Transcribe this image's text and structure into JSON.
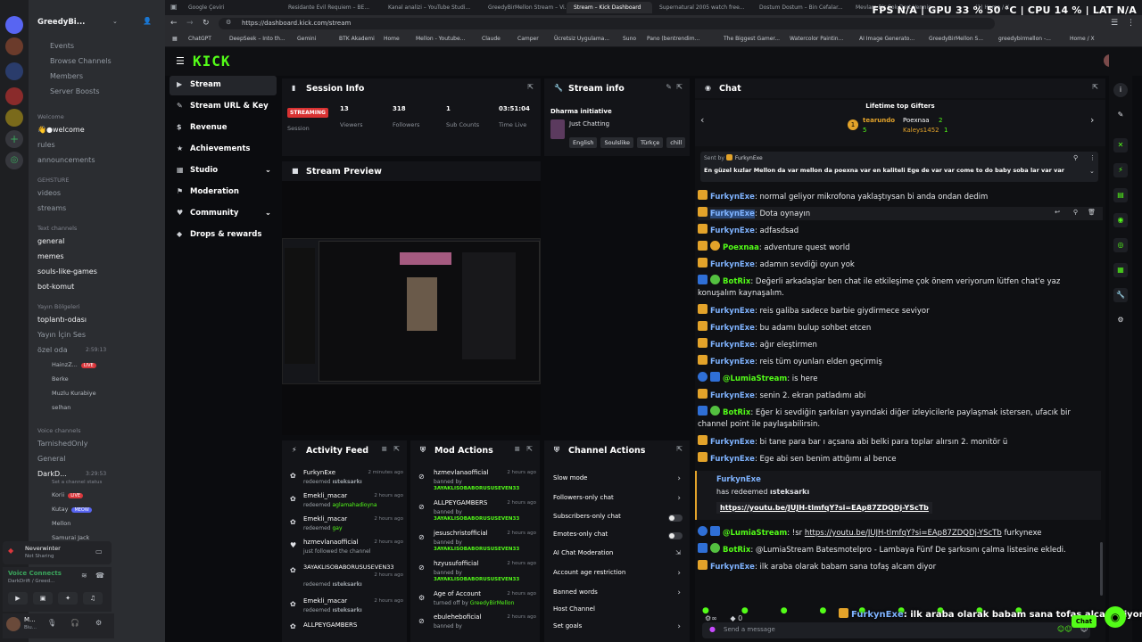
{
  "overlay_stats": "FPS N/A | GPU 33 % 50 °C | CPU 14 % | LAT N/A",
  "discord": {
    "server_name": "GreedyBi...",
    "nav": [
      "Events",
      "Browse Channels",
      "Members",
      "Server Boosts"
    ],
    "cat_welcome": "Welcome",
    "ch_welcome": "👋●welcome",
    "ch_rules": "rules",
    "ch_ann": "announcements",
    "cat_gehsture": "GEHSTURE",
    "ch_videos": "videos",
    "ch_streams": "streams",
    "cat_text": "Text channels",
    "text_channels": [
      "general",
      "memes",
      "souls-like-games",
      "bot-komut"
    ],
    "cat_yayin": "Yayın Bölgeleri",
    "ch_toplanti": "toplantı-odası",
    "ch_yayin_ses": "Yayın İçin Ses",
    "ch_ozel": "özel oda",
    "ozel_time": "2:59:13",
    "voice_users1": [
      {
        "name": "HainzZ...",
        "live": "LIVE"
      },
      {
        "name": "Berke",
        "live": ""
      },
      {
        "name": "Muzlu Kurabiye",
        "live": ""
      },
      {
        "name": "selhan",
        "live": ""
      }
    ],
    "cat_voice": "Voice channels",
    "ch_tarnished": "TarnishedOnly",
    "ch_general_v": "General",
    "ch_darkd": "DarkD...",
    "darkd_time": "3:29:53",
    "darkd_status": "Set a channel status",
    "voice_users2": [
      {
        "name": "Korii",
        "live": "LIVE"
      },
      {
        "name": "Kutay",
        "live": "MEOW"
      },
      {
        "name": "Mellon",
        "live": ""
      },
      {
        "name": "Samurai Jack",
        "live": ""
      }
    ],
    "nw_title": "Neverwinter",
    "nw_sub": "Not Sharing",
    "vc_title": "Voice Connects",
    "vc_sub": "DarkDrift / Greed...",
    "user_name": "M...",
    "user_sub": "Biu..."
  },
  "browser": {
    "tabs": [
      "Google Çeviri",
      "Residante Evil Requiem – BE...",
      "Kanal analizi – YouTube Studi...",
      "GreedyBirMellon Stream – Vi...",
      "Stream – Kick Dashboard",
      "Supernatural 2005 watch free...",
      "Dostum Dostum – Bin Cefalar...",
      "Mevlam Bir Çok Dert Vermiş...",
      "(1) Home / X"
    ],
    "url": "https://dashboard.kick.com/stream",
    "bookmarks": [
      "ChatGPT",
      "DeepSeek – Into th...",
      "Gemini",
      "BTK Akademi",
      "Home",
      "Mellon - Youtube...",
      "Claude",
      "Camper",
      "Ücretsiz Uygulama...",
      "Suno",
      "Pano (bentrendim...",
      "The Biggest Gamer...",
      "Watercolor Paintin...",
      "AI Image Generato...",
      "GreedyBirMellon S...",
      "greedybirmellon -...",
      "Home / X"
    ]
  },
  "kick": {
    "logo": "KICK",
    "nav": [
      {
        "icon": "▶",
        "label": "Stream"
      },
      {
        "icon": "✎",
        "label": "Stream URL & Key"
      },
      {
        "icon": "$",
        "label": "Revenue"
      },
      {
        "icon": "★",
        "label": "Achievements"
      },
      {
        "icon": "▦",
        "label": "Studio"
      },
      {
        "icon": "⚑",
        "label": "Moderation"
      },
      {
        "icon": "♥",
        "label": "Community"
      },
      {
        "icon": "◆",
        "label": "Drops & rewards"
      }
    ],
    "session": {
      "title": "Session Info",
      "live_badge": "STREAMING",
      "live_label": "Session",
      "stats": [
        {
          "value": "13",
          "label": "Viewers"
        },
        {
          "value": "318",
          "label": "Followers"
        },
        {
          "value": "1",
          "label": "Sub Counts"
        },
        {
          "value": "03:51:04",
          "label": "Time Live"
        }
      ]
    },
    "stream_info": {
      "title": "Stream info",
      "stream_title": "Dharma initiative",
      "category": "Just Chatting",
      "tags": [
        "English",
        "Soulslike",
        "Türkçe",
        "chill"
      ]
    },
    "preview_title": "Stream Preview",
    "activity": {
      "title": "Activity Feed",
      "items": [
        {
          "name": "FurkynExe",
          "time": "2 minutes ago",
          "action": "redeemed",
          "detail": "ısteksarkı"
        },
        {
          "name": "Emekli_macar",
          "time": "2 hours ago",
          "action": "redeemed",
          "detail": "aglamahadioyna"
        },
        {
          "name": "Emekli_macar",
          "time": "2 hours ago",
          "action": "redeemed",
          "detail": "gay"
        },
        {
          "name": "hzmevlanaofficial",
          "time": "2 hours ago",
          "action": "just followed the channel",
          "detail": ""
        },
        {
          "name": "3AYAKLISOBABORUSUSEVEN33",
          "time": "",
          "action": "",
          "detail": ""
        },
        {
          "name": "",
          "time": "2 hours ago",
          "action": "redeemed",
          "detail": "ısteksarkı"
        },
        {
          "name": "Emekli_macar",
          "time": "2 hours ago",
          "action": "redeemed",
          "detail": "ısteksarkı"
        },
        {
          "name": "ALLPEYGAMBERS",
          "time": "",
          "action": "",
          "detail": ""
        }
      ]
    },
    "mod": {
      "title": "Mod Actions",
      "items": [
        {
          "name": "hzmevlanaofficial",
          "time": "2 hours ago",
          "action": "banned by",
          "by": "3AYAKLISOBABORUSUSEVEN33"
        },
        {
          "name": "ALLPEYGAMBERS",
          "time": "2 hours ago",
          "action": "banned by",
          "by": "3AYAKLISOBABORUSUSEVEN33"
        },
        {
          "name": "jesuschristofficial",
          "time": "2 hours ago",
          "action": "banned by",
          "by": "3AYAKLISOBABORUSUSEVEN33"
        },
        {
          "name": "hzyusufofficial",
          "time": "2 hours ago",
          "action": "banned by",
          "by": "3AYAKLISOBABORUSUSEVEN33"
        },
        {
          "name": "Age of Account",
          "time": "2 hours ago",
          "action": "turned off by",
          "by": "GreedyBirMellon"
        },
        {
          "name": "ebuleheboficial",
          "time": "2 hours ago",
          "action": "banned by",
          "by": ""
        }
      ]
    },
    "channel_actions": {
      "title": "Channel Actions",
      "items": [
        {
          "label": "Slow mode",
          "control": "chevron"
        },
        {
          "label": "Followers-only chat",
          "control": "chevron"
        },
        {
          "label": "Subscribers-only chat",
          "control": "toggle"
        },
        {
          "label": "Emotes-only chat",
          "control": "toggle"
        },
        {
          "label": "AI Chat Moderation",
          "control": "ext"
        },
        {
          "label": "Account age restriction",
          "control": "chevron"
        },
        {
          "label": "Banned words",
          "control": "chevron"
        },
        {
          "label": "Host Channel",
          "control": ""
        },
        {
          "label": "Set goals",
          "control": "chevron"
        }
      ]
    },
    "chat": {
      "title": "Chat",
      "gifters_title": "Lifetime top Gifters",
      "gifters": [
        {
          "name": "tearundo",
          "count": "5"
        },
        {
          "name": "Poexnaa",
          "count": "2"
        },
        {
          "name": "Kaleys1452",
          "count": "1"
        }
      ],
      "pinned_sent_by": "Sent by",
      "pinned_user": "FurkynExe",
      "pinned_text": "En güzel kızlar Mellon da var mellon da poexna var en kaliteli Ege de var var come to do baby soba lar var var",
      "messages": [
        {
          "user": "FurkynExe",
          "text": ": normal geliyor mikrofona yaklaştıysan bi anda ondan dedim",
          "badge": "gold",
          "color": "#7fb3ff"
        },
        {
          "user": "FurkynExe",
          "text": ": Dota oynayın",
          "badge": "gold",
          "color": "#7fb3ff"
        },
        {
          "user": "FurkynExe",
          "text": ": adfasdsad",
          "badge": "gold",
          "color": "#7fb3ff"
        },
        {
          "user": "Poexnaa",
          "text": ": adventure quest world",
          "badge": "gold",
          "color": "#53fc18"
        },
        {
          "user": "FurkynExe",
          "text": ": adamın sevdiği oyun yok",
          "badge": "gold",
          "color": "#7fb3ff"
        },
        {
          "user": "BotRix",
          "text": ": Değerli arkadaşlar ben chat ile etkileşime çok önem veriyorum lütfen chat'e yaz konuşalım kaynaşalım.",
          "badge": "bot",
          "color": "#53fc18"
        },
        {
          "user": "FurkynExe",
          "text": ": reis galiba sadece barbie giydirmece seviyor",
          "badge": "gold",
          "color": "#7fb3ff"
        },
        {
          "user": "FurkynExe",
          "text": ": bu adamı bulup sohbet etcen",
          "badge": "gold",
          "color": "#7fb3ff"
        },
        {
          "user": "FurkynExe",
          "text": ": ağır eleştirmen",
          "badge": "gold",
          "color": "#7fb3ff"
        },
        {
          "user": "FurkynExe",
          "text": ": reis tüm oyunları elden geçirmiş",
          "badge": "gold",
          "color": "#7fb3ff"
        },
        {
          "user": "@LumiaStream",
          "text": ": is here",
          "badge": "bot",
          "color": "#53fc18"
        },
        {
          "user": "FurkynExe",
          "text": ": senin 2. ekran patladımı abi",
          "badge": "gold",
          "color": "#7fb3ff"
        },
        {
          "user": "BotRix",
          "text": ": Eğer ki sevdiğin şarkıları yayındaki diğer izleyicilerle paylaşmak istersen, ufacık bir channel point ile paylaşabilirsin.",
          "badge": "bot",
          "color": "#53fc18"
        },
        {
          "user": "FurkynExe",
          "text": ": bi tane para bar ı açsana abi belki para toplar alırsın 2. monitör ü",
          "badge": "gold",
          "color": "#7fb3ff"
        },
        {
          "user": "FurkynExe",
          "text": ": Ege abi sen benim attığımı al bence",
          "badge": "gold",
          "color": "#7fb3ff"
        }
      ],
      "redeem": {
        "user": "FurkynExe",
        "text": "has redeemed",
        "reward": "ısteksarkı",
        "link": "https://youtu.be/JUJH-tlmfqY?si=EAp87ZDQDj-YScTb"
      },
      "messages2": [
        {
          "user": "@LumiaStream",
          "text": ": !sr",
          "link": "https://youtu.be/JUJH-tlmfqY?si=EAp87ZDQDj-YScTb",
          "after": " furkynexe",
          "badge": "bot"
        },
        {
          "user": "BotRix",
          "text": ": @LumiaStream Batesmotelpro - Lambaya Fünf De şarkısını çalma listesine ekledi.",
          "badge": "bot"
        },
        {
          "user": "FurkynExe",
          "text": ": ilk araba olarak babam sana tofaş alcam diyor",
          "badge": "gold"
        }
      ],
      "input_placeholder": "Send a message",
      "bottom_count": "0",
      "chat_button": "Chat",
      "overlay_user": "FurkynExe",
      "overlay_text": ": ilk araba olarak babam sana tofaş alcam diyor"
    }
  }
}
